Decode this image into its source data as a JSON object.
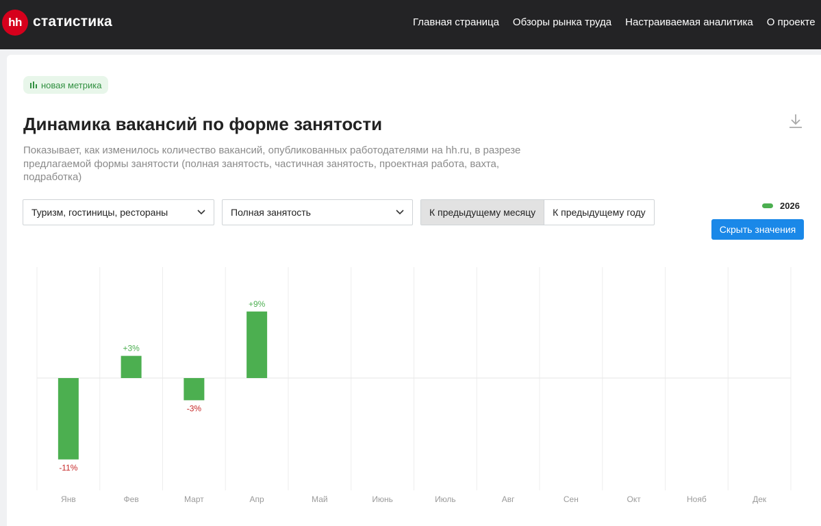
{
  "header": {
    "logo_badge": "hh",
    "logo_text": "статистика",
    "nav": [
      "Главная страница",
      "Обзоры рынка труда",
      "Настраиваемая аналитика",
      "О проекте"
    ]
  },
  "main": {
    "badge": "новая метрика",
    "title": "Динамика вакансий по форме занятости",
    "description": "Показывает, как изменилось количество вакансий, опубликованных работодателями на hh.ru, в разрезе предлагаемой формы занятости (полная занятость, частичная занятость, проектная работа, вахта, подработка)",
    "filters": {
      "industry": "Туризм, гостиницы, рестораны",
      "employment": "Полная занятость"
    },
    "compare": {
      "month": "К предыдущему месяцу",
      "year": "К предыдущему году",
      "selected": "month"
    },
    "legend_label": "2026",
    "hide_values_button": "Скрыть значения"
  },
  "colors": {
    "bar": "#4caf50",
    "positive_label": "#4caf50",
    "negative_label": "#c62828",
    "button": "#1a88e8"
  },
  "chart_data": {
    "type": "bar",
    "categories": [
      "Янв",
      "Фев",
      "Март",
      "Апр",
      "Май",
      "Июнь",
      "Июль",
      "Авг",
      "Сен",
      "Окт",
      "Нояб",
      "Дек"
    ],
    "series": [
      {
        "name": "2026",
        "values": [
          -11,
          3,
          -3,
          9,
          null,
          null,
          null,
          null,
          null,
          null,
          null,
          null
        ]
      }
    ],
    "data_labels": [
      "-11%",
      "+3%",
      "-3%",
      "+9%"
    ],
    "grid": true
  }
}
